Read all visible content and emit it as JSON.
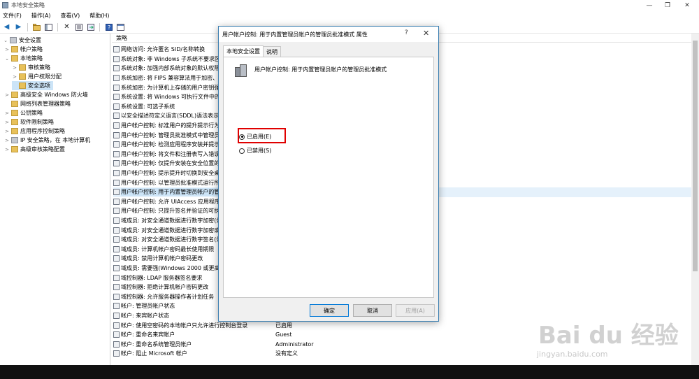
{
  "window": {
    "title": "本地安全策略",
    "minimize": "—",
    "maximize": "❐",
    "close": "✕"
  },
  "menu": [
    "文件(F)",
    "操作(A)",
    "查看(V)",
    "帮助(H)"
  ],
  "tree": [
    {
      "label": "安全设置",
      "level": 0,
      "expander": "⌄",
      "icon": "shield"
    },
    {
      "label": "帐户策略",
      "level": 1,
      "expander": ">",
      "icon": "folder"
    },
    {
      "label": "本地策略",
      "level": 1,
      "expander": "⌄",
      "icon": "folder"
    },
    {
      "label": "审核策略",
      "level": 2,
      "expander": ">",
      "icon": "folder"
    },
    {
      "label": "用户权限分配",
      "level": 2,
      "expander": ">",
      "icon": "folder"
    },
    {
      "label": "安全选项",
      "level": 2,
      "expander": "",
      "icon": "folder",
      "selected": true
    },
    {
      "label": "高级安全 Windows 防火墙",
      "level": 1,
      "expander": ">",
      "icon": "folder"
    },
    {
      "label": "网络列表管理器策略",
      "level": 1,
      "expander": "",
      "icon": "folder"
    },
    {
      "label": "公钥策略",
      "level": 1,
      "expander": ">",
      "icon": "folder"
    },
    {
      "label": "软件限制策略",
      "level": 1,
      "expander": ">",
      "icon": "folder"
    },
    {
      "label": "应用程序控制策略",
      "level": 1,
      "expander": ">",
      "icon": "folder"
    },
    {
      "label": "IP 安全策略，在 本地计算机",
      "level": 1,
      "expander": ">",
      "icon": "shield"
    },
    {
      "label": "高级审核策略配置",
      "level": 1,
      "expander": ">",
      "icon": "folder"
    }
  ],
  "list": {
    "col_policy": "策略",
    "rows": [
      {
        "text": "网络访问: 允许匿名 SID/名称转换",
        "value": ""
      },
      {
        "text": "系统对象: 非 Windows 子系统不要求区",
        "value": ""
      },
      {
        "text": "系统对象: 加强内部系统对象的默认权限",
        "value": ""
      },
      {
        "text": "系统加密: 将 FIPS 兼容算法用于加密、",
        "value": ""
      },
      {
        "text": "系统加密: 为计算机上存储的用户密钥强",
        "value": ""
      },
      {
        "text": "系统设置: 将 Windows 可执行文件中的",
        "value": ""
      },
      {
        "text": "系统设置: 可选子系统",
        "value": ""
      },
      {
        "text": "以安全描述符定义语言(SDDL)语法表示的",
        "value": ""
      },
      {
        "text": "用户帐户控制: 标准用户的提升提示行为",
        "value": ""
      },
      {
        "text": "用户帐户控制: 管理员批准模式中管理员",
        "value": ""
      },
      {
        "text": "用户帐户控制: 检测应用程序安装并提示",
        "value": ""
      },
      {
        "text": "用户帐户控制: 将文件和注册表写入错误",
        "value": ""
      },
      {
        "text": "用户帐户控制: 仅提升安装在安全位置的",
        "value": ""
      },
      {
        "text": "用户帐户控制: 提示提升时切换到安全桌",
        "value": ""
      },
      {
        "text": "用户帐户控制: 以管理员批准模式运行所",
        "value": ""
      },
      {
        "text": "用户帐户控制: 用于内置管理员帐户的管",
        "value": "",
        "highlight": true
      },
      {
        "text": "用户帐户控制: 允许 UIAccess 应用程序",
        "value": ""
      },
      {
        "text": "用户帐户控制: 只提升签名并验证的可执",
        "value": ""
      },
      {
        "text": "域成员: 对安全通道数据进行数字加密(如",
        "value": ""
      },
      {
        "text": "域成员: 对安全通道数据进行数字加密或",
        "value": ""
      },
      {
        "text": "域成员: 对安全通道数据进行数字签名(如",
        "value": ""
      },
      {
        "text": "域成员: 计算机帐户密码最长使用期限",
        "value": ""
      },
      {
        "text": "域成员: 禁用计算机帐户密码更改",
        "value": ""
      },
      {
        "text": "域成员: 需要强(Windows 2000 或更高",
        "value": ""
      },
      {
        "text": "域控制器: LDAP 服务器签名要求",
        "value": ""
      },
      {
        "text": "域控制器: 拒绝计算机帐户密码更改",
        "value": ""
      },
      {
        "text": "域控制器: 允许服务器操作者计划任务",
        "value": ""
      },
      {
        "text": "帐户: 管理员帐户状态",
        "value": ""
      },
      {
        "text": "帐户: 来宾帐户状态",
        "value": ""
      },
      {
        "text": "帐户: 使用空密码的本地帐户只允许进行控制台登录",
        "value": "已启用"
      },
      {
        "text": "帐户: 重命名来宾帐户",
        "value": "Guest"
      },
      {
        "text": "帐户: 重命名系统管理员帐户",
        "value": "Administrator"
      },
      {
        "text": "帐户: 阻止 Microsoft 帐户",
        "value": "没有定义"
      }
    ]
  },
  "dialog": {
    "title": "用户帐户控制: 用于内置管理员帐户的管理员批准模式 属性",
    "help": "?",
    "close": "✕",
    "tabs": [
      "本地安全设置",
      "说明"
    ],
    "policy_name": "用户帐户控制: 用于内置管理员帐户的管理员批准模式",
    "options": [
      {
        "label": "已启用(E)",
        "checked": true
      },
      {
        "label": "已禁用(S)",
        "checked": false
      }
    ],
    "buttons": {
      "ok": "确定",
      "cancel": "取消",
      "apply": "应用(A)"
    }
  },
  "watermark": {
    "brand": "Bai du 经验",
    "url": "jingyan.baidu.com"
  },
  "colors": {
    "selection": "#cce4f7",
    "accent": "#0078d7",
    "highlight_box": "#e00000"
  }
}
